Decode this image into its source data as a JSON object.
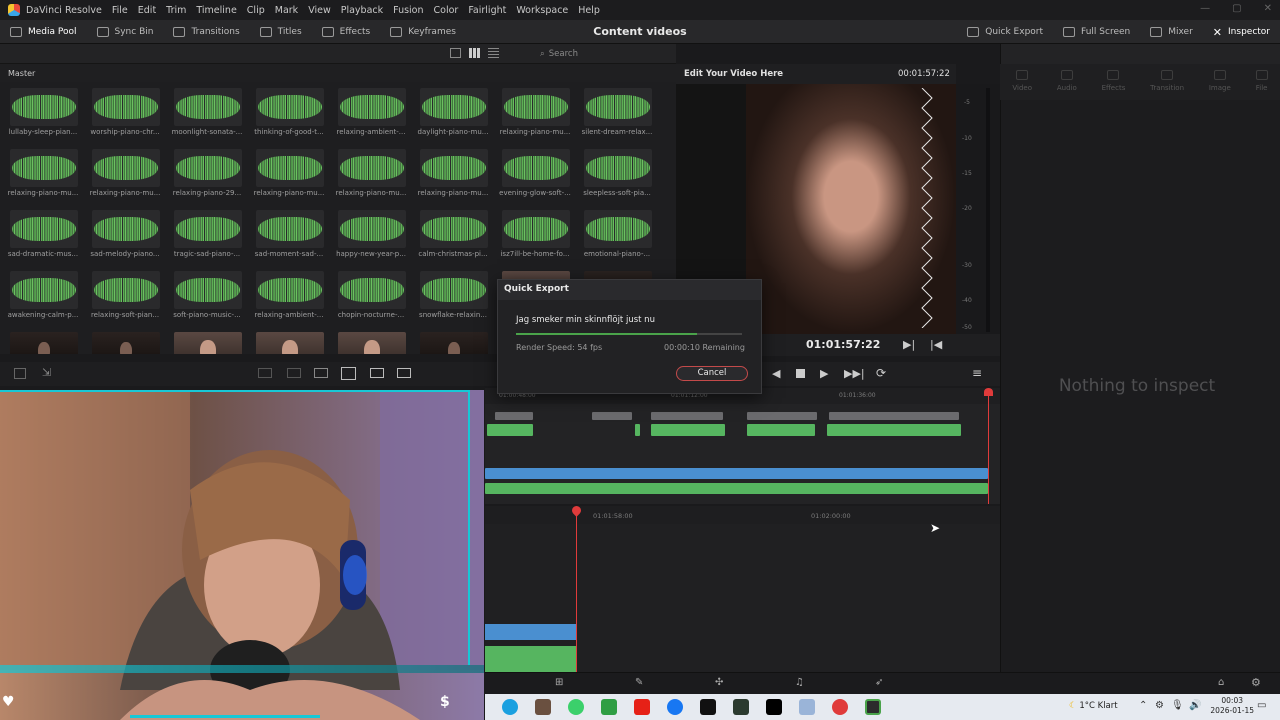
{
  "menubar": {
    "app_name": "DaVinci Resolve",
    "items": [
      "File",
      "Edit",
      "Trim",
      "Timeline",
      "Clip",
      "Mark",
      "View",
      "Playback",
      "Fusion",
      "Color",
      "Fairlight",
      "Workspace",
      "Help"
    ]
  },
  "toolbar": {
    "left": [
      "Media Pool",
      "Sync Bin",
      "Transitions",
      "Titles",
      "Effects",
      "Keyframes"
    ],
    "project_title": "Content videos",
    "right": [
      "Quick Export",
      "Full Screen",
      "Mixer",
      "Inspector"
    ]
  },
  "media_pool": {
    "search_placeholder": "Search",
    "breadcrumb": "Master",
    "clips": [
      {
        "name": "lullaby-sleep-pian...",
        "kind": "wav"
      },
      {
        "name": "worship-piano-chr...",
        "kind": "wav"
      },
      {
        "name": "moonlight-sonata-...",
        "kind": "wav"
      },
      {
        "name": "thinking-of-good-t...",
        "kind": "wav"
      },
      {
        "name": "relaxing-ambient-...",
        "kind": "wav"
      },
      {
        "name": "daylight-piano-mu...",
        "kind": "wav"
      },
      {
        "name": "relaxing-piano-mu...",
        "kind": "wav"
      },
      {
        "name": "silent-dream-relax...",
        "kind": "wav"
      },
      {
        "name": "relaxing-piano-mu...",
        "kind": "wav"
      },
      {
        "name": "relaxing-piano-mu...",
        "kind": "wav"
      },
      {
        "name": "relaxing-piano-29...",
        "kind": "wav"
      },
      {
        "name": "relaxing-piano-mu...",
        "kind": "wav"
      },
      {
        "name": "relaxing-piano-mu...",
        "kind": "wav"
      },
      {
        "name": "relaxing-piano-mu...",
        "kind": "wav"
      },
      {
        "name": "evening-glow-soft-...",
        "kind": "wav"
      },
      {
        "name": "sleepless-soft-pia...",
        "kind": "wav"
      },
      {
        "name": "sad-dramatic-mus...",
        "kind": "wav"
      },
      {
        "name": "sad-melody-piano...",
        "kind": "wav"
      },
      {
        "name": "tragic-sad-piano-...",
        "kind": "wav"
      },
      {
        "name": "sad-moment-sad-...",
        "kind": "wav"
      },
      {
        "name": "happy-new-year-p...",
        "kind": "wav"
      },
      {
        "name": "calm-christmas-pi...",
        "kind": "wav"
      },
      {
        "name": "isz7ill-be-home-fo...",
        "kind": "wav"
      },
      {
        "name": "emotional-piano-...",
        "kind": "wav"
      },
      {
        "name": "awakening-calm-p...",
        "kind": "wav"
      },
      {
        "name": "relaxing-soft-pian...",
        "kind": "wav"
      },
      {
        "name": "soft-piano-music-...",
        "kind": "wav"
      },
      {
        "name": "relaxing-ambient-...",
        "kind": "wav"
      },
      {
        "name": "chopin-nocturne-...",
        "kind": "wav"
      },
      {
        "name": "snowflake-relaxin...",
        "kind": "wav"
      },
      {
        "name": "",
        "kind": "vid"
      },
      {
        "name": "",
        "kind": "dark"
      },
      {
        "name": "",
        "kind": "dark"
      },
      {
        "name": "",
        "kind": "dark"
      },
      {
        "name": "",
        "kind": "vid"
      },
      {
        "name": "",
        "kind": "vid"
      },
      {
        "name": "",
        "kind": "vid"
      },
      {
        "name": "",
        "kind": "dark"
      }
    ]
  },
  "viewer": {
    "title": "Edit Your Video Here",
    "timecode_small": "00:01:57:22",
    "timecode_big": "01:01:57:22",
    "meter_ticks": [
      "-5",
      "-10",
      "-15",
      "-20",
      "-30",
      "-40",
      "-50"
    ]
  },
  "quick_export": {
    "title": "Quick Export",
    "file_name": "Jag smeker min skinnflöjt just nu",
    "progress": 0.8,
    "render_speed": "Render Speed: 54 fps",
    "remaining": "00:00:10 Remaining",
    "cancel_label": "Cancel"
  },
  "inspector": {
    "tabs": [
      "Video",
      "Audio",
      "Effects",
      "Transition",
      "Image",
      "File"
    ],
    "empty_message": "Nothing to inspect"
  },
  "timeline": {
    "ruler_upper": [
      "01:00:48:00",
      "01:01:12:00",
      "01:01:36:00"
    ],
    "ruler_lower": [
      "01:01:58:00",
      "01:02:00:00"
    ]
  },
  "taskbar": {
    "weather": "1°C  Klart",
    "time": "00:03",
    "date": "2026-01-15"
  },
  "colors": {
    "clip_green": "#56b560",
    "clip_blue": "#4a8fd0",
    "playhead_red": "#e03b3b",
    "accent_cyan": "#17c8d6"
  }
}
